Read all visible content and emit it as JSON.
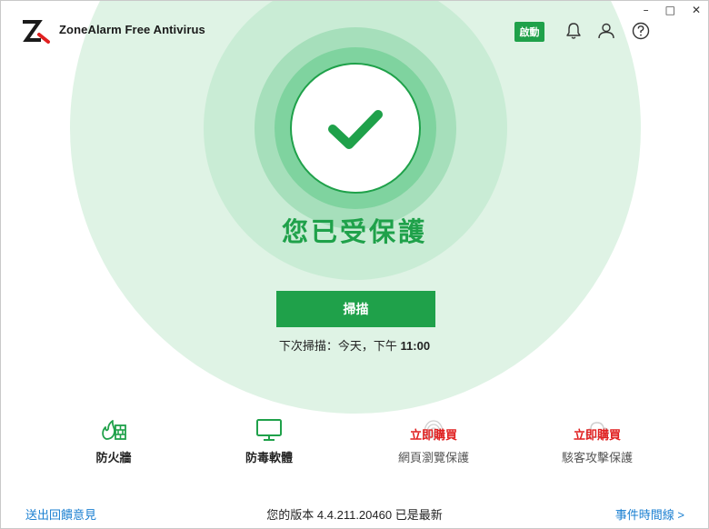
{
  "window": {
    "controls": [
      "–",
      "□",
      "✕"
    ]
  },
  "header": {
    "title": "ZoneAlarm Free Antivirus",
    "activate_label": "啟動",
    "icons": [
      "bell-icon",
      "user-icon",
      "help-icon"
    ]
  },
  "status": {
    "message": "您已受保護"
  },
  "scan": {
    "button_label": "掃描",
    "next_scan_prefix": "下次掃描：今天，下午 ",
    "next_scan_time": "11:00"
  },
  "features": [
    {
      "label": "防火牆",
      "icon": "firewall-icon",
      "locked": false
    },
    {
      "label": "防毒軟體",
      "icon": "monitor-icon",
      "locked": false
    },
    {
      "label": "網頁瀏覽保護",
      "icon": "fingerprint-icon",
      "locked": true,
      "buy_label": "立即購買"
    },
    {
      "label": "駭客攻擊保護",
      "icon": "cloud-icon",
      "locked": true,
      "buy_label": "立即購買"
    }
  ],
  "footer": {
    "feedback_link": "送出回饋意見",
    "version_text": "您的版本 4.4.211.20460 已是最新",
    "timeline_link": "事件時間線 >"
  },
  "colors": {
    "accent": "#1fa14a",
    "buy": "#e02020",
    "link": "#1a7fd1"
  }
}
